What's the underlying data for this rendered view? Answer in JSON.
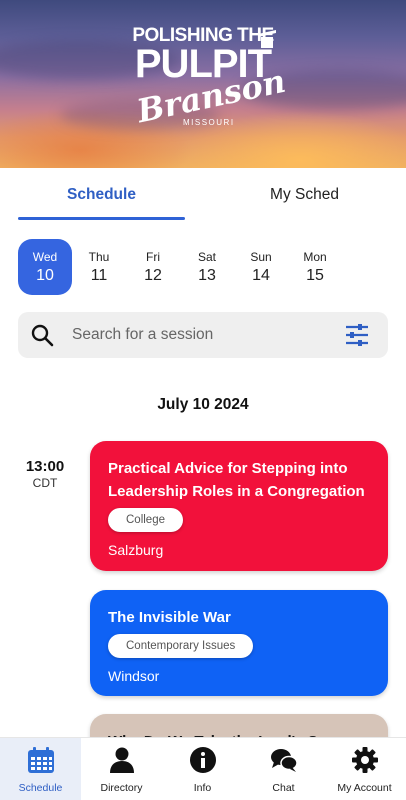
{
  "header": {
    "logo_line1": "POLISHING THE",
    "logo_line2": "PULPIT",
    "logo_line3": "Branson",
    "logo_line4": "MISSOURI"
  },
  "tabs": [
    {
      "label": "Schedule",
      "active": true
    },
    {
      "label": "My Sched",
      "active": false
    }
  ],
  "days": [
    {
      "name": "Wed",
      "num": "10",
      "selected": true
    },
    {
      "name": "Thu",
      "num": "11",
      "selected": false
    },
    {
      "name": "Fri",
      "num": "12",
      "selected": false
    },
    {
      "name": "Sat",
      "num": "13",
      "selected": false
    },
    {
      "name": "Sun",
      "num": "14",
      "selected": false
    },
    {
      "name": "Mon",
      "num": "15",
      "selected": false
    }
  ],
  "search": {
    "placeholder": "Search for a session",
    "icon": "search-icon",
    "filter_icon": "filter-sliders-icon"
  },
  "date_heading": "July 10 2024",
  "time_slot": {
    "time": "13:00",
    "zone": "CDT"
  },
  "sessions": [
    {
      "title": "Practical Advice for Stepping into Leadership Roles in a Congregation",
      "tag": "College",
      "location": "Salzburg",
      "color": "#f2113b"
    },
    {
      "title": "The Invisible War",
      "tag": "Contemporary Issues",
      "location": "Windsor",
      "color": "#0f62f5"
    },
    {
      "title": "Why Do We Take the Lord's Supper",
      "color": "#d6c4b8"
    }
  ],
  "nav": [
    {
      "label": "Schedule",
      "icon": "calendar-icon",
      "active": true
    },
    {
      "label": "Directory",
      "icon": "person-icon",
      "active": false
    },
    {
      "label": "Info",
      "icon": "info-icon",
      "active": false
    },
    {
      "label": "Chat",
      "icon": "chat-icon",
      "active": false
    },
    {
      "label": "My Account",
      "icon": "gear-icon",
      "active": false
    }
  ],
  "colors": {
    "accent": "#2f5fc4",
    "selected_day": "#3565e0"
  }
}
